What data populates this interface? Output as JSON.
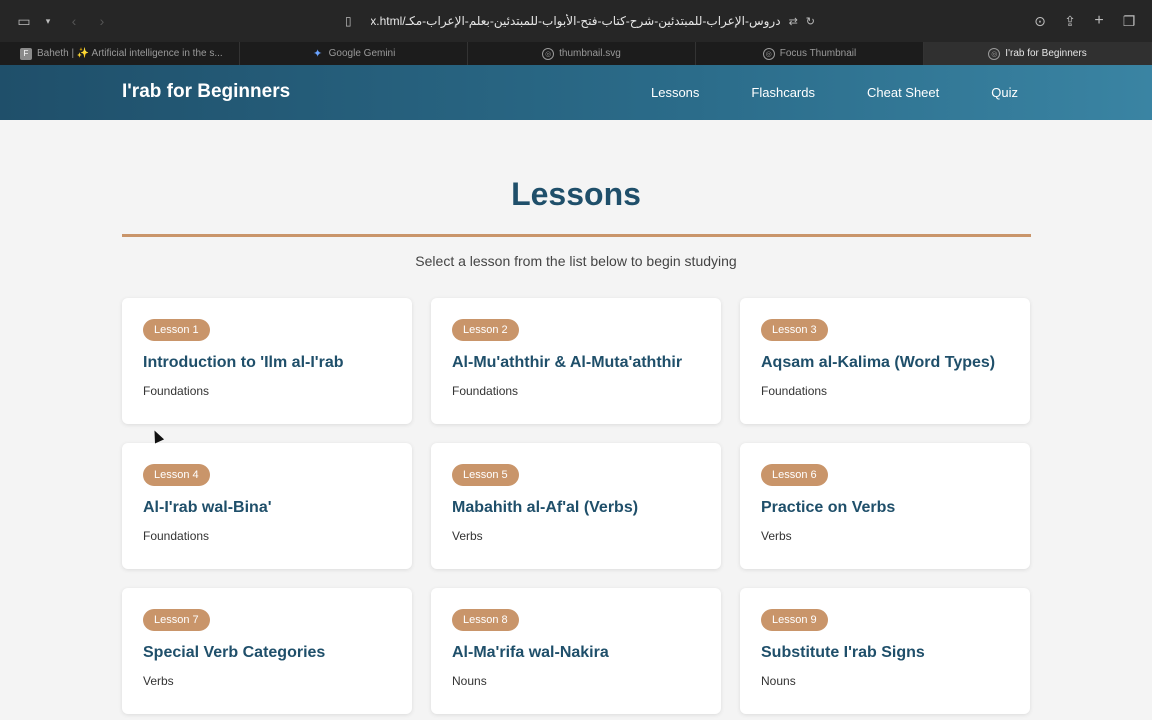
{
  "browser": {
    "url": "دروس-الإعراب-للمبتدئين-شرح-كتاب-فتح-الأبواب-للمبتدئين-بعلم-الإعراب-مكـ/index.html",
    "tabs": [
      {
        "label": "Baheth | ✨ Artificial intelligence in the s...",
        "icon": "f-favicon-icon",
        "active": false
      },
      {
        "label": "Google Gemini",
        "icon": "gemini-icon",
        "active": false
      },
      {
        "label": "thumbnail.svg",
        "icon": "compass-icon",
        "active": false
      },
      {
        "label": "Focus Thumbnail",
        "icon": "compass-icon",
        "active": false
      },
      {
        "label": "I'rab for Beginners",
        "icon": "compass-icon",
        "active": true
      }
    ]
  },
  "site": {
    "title": "I'rab for Beginners",
    "nav": [
      "Lessons",
      "Flashcards",
      "Cheat Sheet",
      "Quiz"
    ]
  },
  "main": {
    "title": "Lessons",
    "subtitle": "Select a lesson from the list below to begin studying",
    "lessons": [
      {
        "badge": "Lesson 1",
        "title": "Introduction to 'Ilm al-I'rab",
        "category": "Foundations"
      },
      {
        "badge": "Lesson 2",
        "title": "Al-Mu'aththir & Al-Muta'aththir",
        "category": "Foundations"
      },
      {
        "badge": "Lesson 3",
        "title": "Aqsam al-Kalima (Word Types)",
        "category": "Foundations"
      },
      {
        "badge": "Lesson 4",
        "title": "Al-I'rab wal-Bina'",
        "category": "Foundations"
      },
      {
        "badge": "Lesson 5",
        "title": "Mabahith al-Af'al (Verbs)",
        "category": "Verbs"
      },
      {
        "badge": "Lesson 6",
        "title": "Practice on Verbs",
        "category": "Verbs"
      },
      {
        "badge": "Lesson 7",
        "title": "Special Verb Categories",
        "category": "Verbs"
      },
      {
        "badge": "Lesson 8",
        "title": "Al-Ma'rifa wal-Nakira",
        "category": "Nouns"
      },
      {
        "badge": "Lesson 9",
        "title": "Substitute I'rab Signs",
        "category": "Nouns"
      }
    ]
  },
  "colors": {
    "header": "#2b6c8a",
    "accent": "#c9956a",
    "title": "#1f4f6a"
  }
}
